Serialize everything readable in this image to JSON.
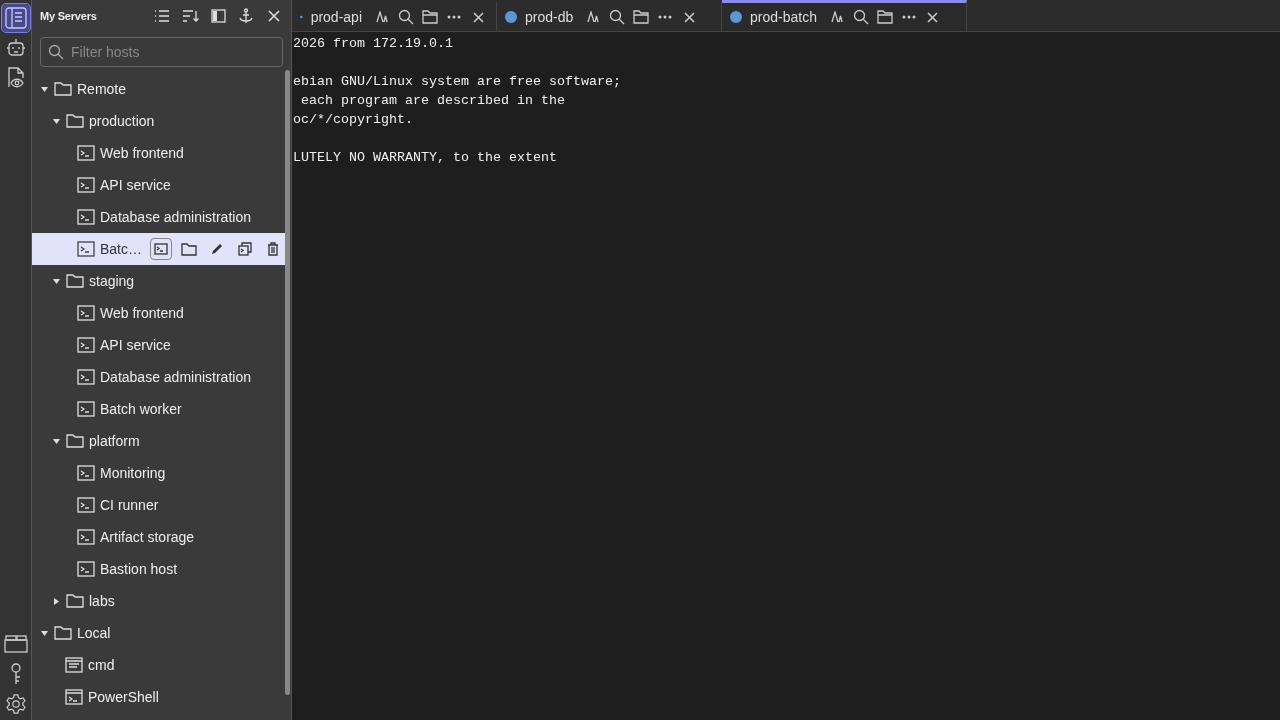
{
  "activity_bar": {
    "top": [
      {
        "kind": "servers",
        "selected": true
      },
      {
        "kind": "robot",
        "selected": false
      },
      {
        "kind": "viewer",
        "selected": false
      }
    ],
    "bottom": [
      {
        "kind": "windows",
        "selected": false
      },
      {
        "kind": "key",
        "selected": false
      },
      {
        "kind": "settings",
        "selected": false
      }
    ]
  },
  "panel": {
    "title": "My Servers",
    "filter": {
      "placeholder": "Filter hosts"
    },
    "tree": [
      {
        "label": "Remote",
        "kind": "folder",
        "expanded": true,
        "selected": false,
        "children": [
          {
            "label": "production",
            "kind": "folder",
            "expanded": true,
            "selected": false,
            "children": [
              {
                "label": "Web frontend",
                "kind": "ssh",
                "selected": false
              },
              {
                "label": "API service",
                "kind": "ssh",
                "selected": false
              },
              {
                "label": "Database administration",
                "kind": "ssh",
                "selected": false
              },
              {
                "label": "Batc…",
                "kind": "ssh",
                "selected": true
              }
            ]
          },
          {
            "label": "staging",
            "kind": "folder",
            "expanded": true,
            "selected": false,
            "children": [
              {
                "label": "Web frontend",
                "kind": "ssh",
                "selected": false
              },
              {
                "label": "API service",
                "kind": "ssh",
                "selected": false
              },
              {
                "label": "Database administration",
                "kind": "ssh",
                "selected": false
              },
              {
                "label": "Batch worker",
                "kind": "ssh",
                "selected": false
              }
            ]
          },
          {
            "label": "platform",
            "kind": "folder",
            "expanded": true,
            "selected": false,
            "children": [
              {
                "label": "Monitoring",
                "kind": "ssh",
                "selected": false
              },
              {
                "label": "CI runner",
                "kind": "ssh",
                "selected": false
              },
              {
                "label": "Artifact storage",
                "kind": "ssh",
                "selected": false
              },
              {
                "label": "Bastion host",
                "kind": "ssh",
                "selected": false
              }
            ]
          },
          {
            "label": "labs",
            "kind": "folder",
            "expanded": false,
            "selected": false
          }
        ]
      },
      {
        "label": "Local",
        "kind": "folder",
        "expanded": true,
        "selected": false,
        "children": [
          {
            "label": "cmd",
            "kind": "cmd",
            "selected": false
          },
          {
            "label": "PowerShell",
            "kind": "powershell",
            "selected": false
          }
        ]
      }
    ]
  },
  "tabs": [
    {
      "label": "prod-api",
      "selected": false
    },
    {
      "label": "prod-db",
      "selected": false
    },
    {
      "label": "prod-batch",
      "selected": true
    }
  ],
  "terminal": {
    "paragraphs": [
      [
        "2026 from 172.19.0.1"
      ],
      [
        "ebian GNU/Linux system are free software;",
        " each program are described in the",
        "oc/*/copyright."
      ],
      [
        "LUTELY NO WARRANTY, to the extent"
      ]
    ]
  }
}
